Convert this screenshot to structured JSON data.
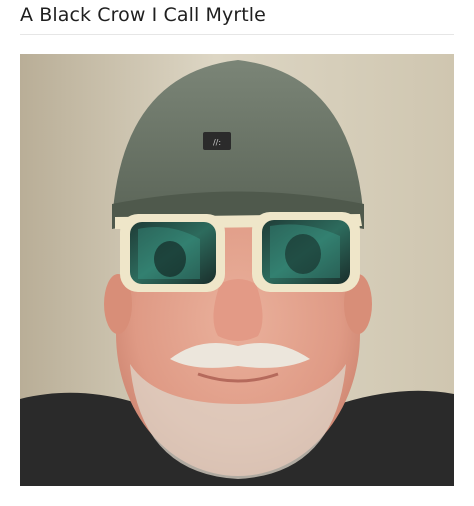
{
  "post": {
    "title": "A Black Crow I Call Myrtle"
  },
  "photo": {
    "subject_icon": "portrait-photo",
    "colors": {
      "wall": "#d9d2c0",
      "wall_shadow": "#b9ae97",
      "beanie": "#6b7567",
      "beanie_dark": "#4a5448",
      "skin": "#e7a58f",
      "skin_dark": "#cc7f6c",
      "beard": "#e4ddd3",
      "shirt": "#2c2c2c",
      "frame": "#efe6c9",
      "lens": "#24463f",
      "lens_tint": "#2fa58e"
    }
  }
}
